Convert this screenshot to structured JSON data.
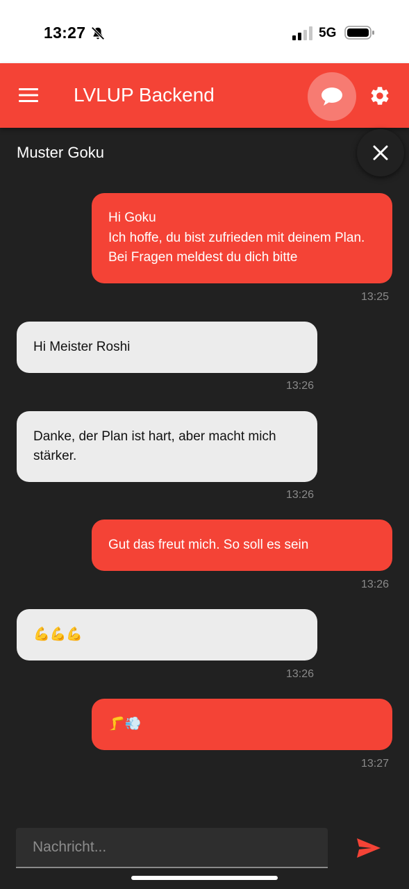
{
  "status_bar": {
    "time": "13:27",
    "network": "5G"
  },
  "app_bar": {
    "title": "LVLUP Backend"
  },
  "chat": {
    "contact_name": "Muster Goku",
    "messages": [
      {
        "direction": "out",
        "text": "Hi Goku\nIch hoffe, du bist zufrieden mit deinem Plan. Bei Fragen meldest du dich bitte",
        "time": "13:25"
      },
      {
        "direction": "in",
        "text": "Hi Meister Roshi",
        "time": "13:26"
      },
      {
        "direction": "in",
        "text": "Danke, der Plan ist hart, aber macht mich stärker.",
        "time": "13:26"
      },
      {
        "direction": "out",
        "text": "Gut das freut mich. So soll es sein",
        "time": "13:26"
      },
      {
        "direction": "in",
        "text": "💪💪💪",
        "time": "13:26"
      },
      {
        "direction": "out",
        "text": "🦵💨",
        "time": "13:27"
      }
    ]
  },
  "composer": {
    "placeholder": "Nachricht..."
  },
  "colors": {
    "accent": "#f44336",
    "background": "#212121",
    "incoming_bubble": "#ececec"
  },
  "icons": [
    "bell-slash-icon",
    "signal-icon",
    "battery-icon",
    "menu-icon",
    "chat-bubble-icon",
    "gear-icon",
    "close-icon",
    "send-icon"
  ]
}
